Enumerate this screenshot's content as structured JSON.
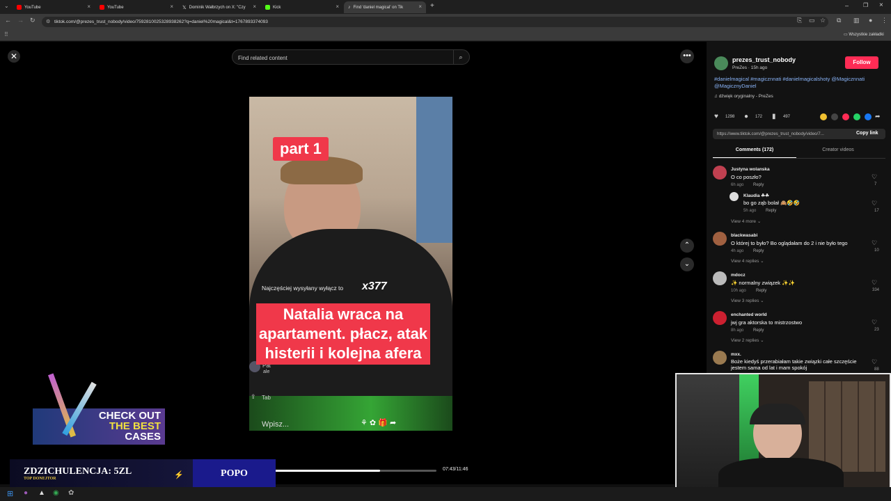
{
  "browser": {
    "tabs": [
      {
        "title": "YouTube"
      },
      {
        "title": "YouTube"
      },
      {
        "title": "Dominik Wałbrzych on X: \"Czy"
      },
      {
        "title": "Kick"
      },
      {
        "title": "Find 'daniel magical' on Tik"
      }
    ],
    "url": "tiktok.com/@prezes_trust_nobody/video/7592810025328938262?q=daniel%20magical&t=1767893374093",
    "bookmarks_folder": "Wszystkie zakładki"
  },
  "search": {
    "placeholder": "Find related content"
  },
  "video": {
    "part_label": "part 1",
    "gift_text": "Najczęściej wysyłany wyłącz to",
    "multiplier": "x377",
    "caption": "Natalia wraca na apartament. płacz, atak histerii i kolejna afera",
    "comment_placeholder": "Wpisz...",
    "overlay_name": "Pat",
    "overlay_text": "ale",
    "tab_label": "Tab",
    "progress_fraction": 0.65,
    "time": "07:43/11:46"
  },
  "post": {
    "username": "prezes_trust_nobody",
    "subline": "PreZes · 15h ago",
    "follow_label": "Follow",
    "hashtags": "#danielmagical #magicznnati #danielmagicalshoty @Magicznnati @MagicznyDaniel",
    "sound": "dźwięk oryginalny - PreZes",
    "likes": "1298",
    "comments": "172",
    "saves": "497",
    "link": "https://www.tiktok.com/@prezes_trust_nobody/video/7...",
    "copy_label": "Copy link",
    "tab_comments": "Comments (172)",
    "tab_creator": "Creator videos"
  },
  "comments": [
    {
      "user": "Justyna wolanska",
      "text": "O co poszło?",
      "time": "6h ago",
      "reply": "Reply",
      "likes": "7",
      "avatar_color": "#c04050"
    },
    {
      "user": "Klaudia ☘☘",
      "text": "bo go ząb bolał 🙈🤣🤣",
      "time": "5h ago",
      "reply": "Reply",
      "likes": "17",
      "avatar_color": "#dddddd"
    },
    {
      "user": "blackwasabi",
      "text": "O której to było? Bo oglądałam do 2 i nie było tego",
      "time": "4h ago",
      "reply": "Reply",
      "likes": "10",
      "avatar_color": "#a06040"
    },
    {
      "user": "mdocz",
      "text": "✨ normalny związek ✨✨",
      "time": "10h ago",
      "reply": "Reply",
      "likes": "334",
      "avatar_color": "#bbbbbb"
    },
    {
      "user": "enchanted world",
      "text": "jwj gra aktorska to mistrzostwo",
      "time": "8h ago",
      "reply": "Reply",
      "likes": "23",
      "avatar_color": "#cc2030"
    },
    {
      "user": "mxx.",
      "text": "Boże kiedyś przerabiałam takie związki całe szczęście jestem sama od lat i mam spokój",
      "time": "",
      "reply": "",
      "likes": "88",
      "avatar_color": "#9a7a50"
    }
  ],
  "view_more": [
    "View 4 more",
    "View 4 replies",
    "View 3 replies",
    "View 2 replies"
  ],
  "stream": {
    "promo_line1": "CHECK OUT",
    "promo_line2": "THE BEST",
    "promo_line3": "CASES",
    "donation": "ZDZICHULENCJA: 5ZL",
    "donation_sub": "TOP DONEJTOR",
    "tag": "POPO"
  },
  "colors": {
    "accent": "#fe2c55",
    "page_bg": "#000000",
    "sidebar_bg": "#121212",
    "caption_bg": "#f0384a"
  }
}
